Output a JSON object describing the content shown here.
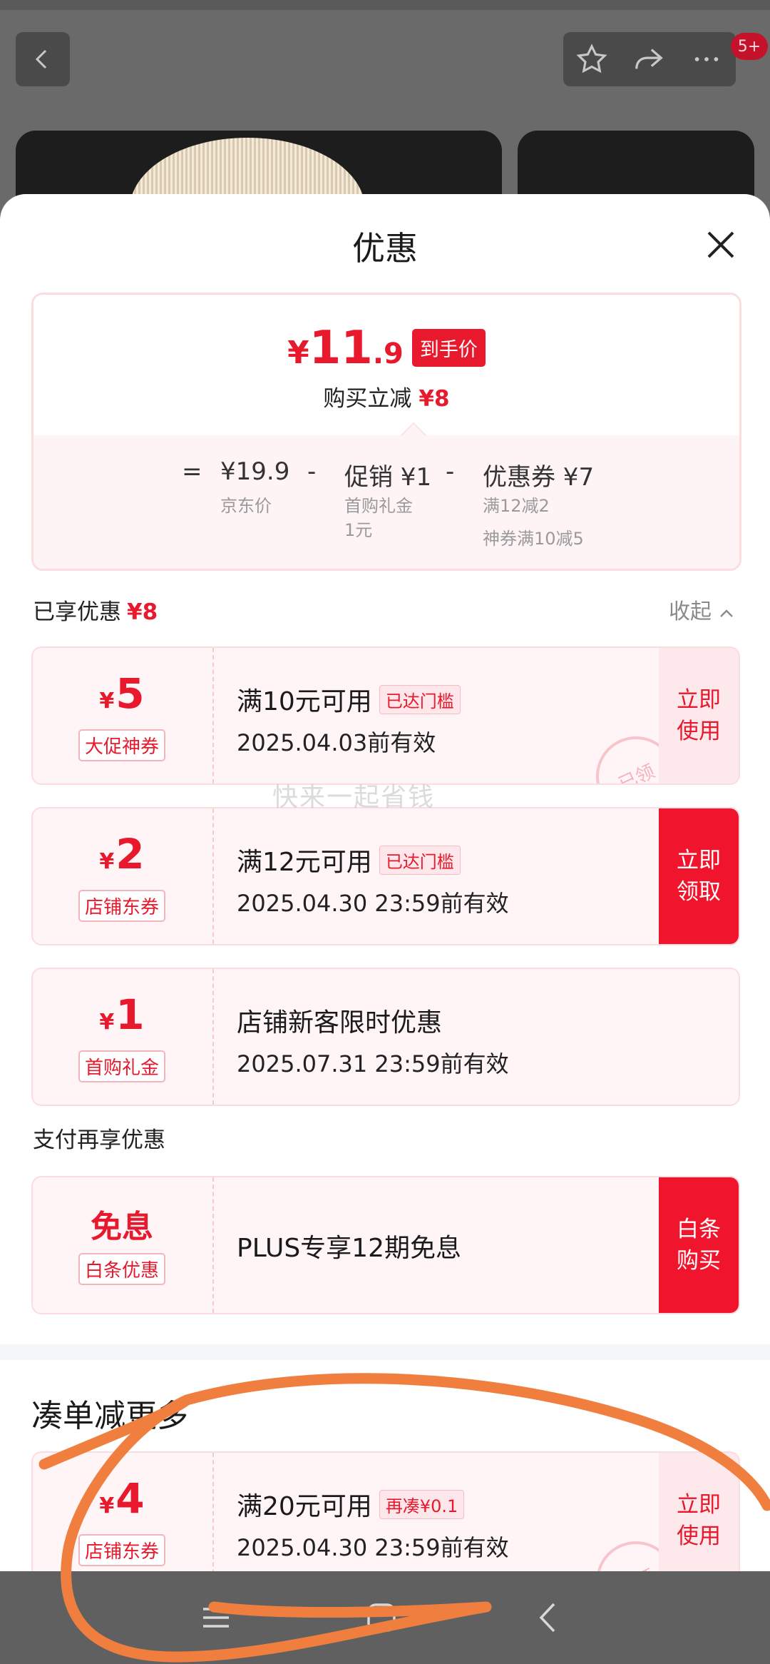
{
  "topbar": {
    "badge": "5+",
    "icons": [
      "back-icon",
      "star-icon",
      "share-icon",
      "more-icon"
    ]
  },
  "sheet": {
    "title": "优惠",
    "price": {
      "currency": "¥",
      "integer": "11",
      "decimal": ".9",
      "tag": "到手价",
      "reduce_label": "购买立减",
      "reduce_amount": "¥8"
    },
    "calc": {
      "equals": "=",
      "minus": "-",
      "base_value": "¥19.9",
      "base_label": "京东价",
      "promo_value": "促销 ¥1",
      "promo_note1": "首购礼金",
      "promo_note2": "1元",
      "coupon_value": "优惠券 ¥7",
      "coupon_note1": "满12减2",
      "coupon_note2": "神券满10减5"
    },
    "enjoyed": {
      "label": "已享优惠",
      "amount": "¥8",
      "collapse_label": "收起"
    },
    "coupons": [
      {
        "currency": "¥",
        "amount": "5",
        "type": "大促神券",
        "condition": "满10元可用",
        "badge": "已达门槛",
        "valid": "2025.04.03前有效",
        "button": "立即\n使用",
        "stamp": "已领"
      },
      {
        "currency": "¥",
        "amount": "2",
        "type": "店铺东券",
        "condition": "满12元可用",
        "badge": "已达门槛",
        "valid": "2025.04.30 23:59前有效",
        "button": "立即\n领取"
      },
      {
        "currency": "¥",
        "amount": "1",
        "type": "首购礼金",
        "title": "店铺新客限时优惠",
        "valid": "2025.07.31 23:59前有效"
      }
    ],
    "pay": {
      "label": "支付再享优惠",
      "word": "免息",
      "type": "白条优惠",
      "title": "PLUS专享12期免息",
      "button": "白条\n购买"
    },
    "watermark": "快来一起省钱",
    "more": {
      "title": "凑单减更多",
      "coupon": {
        "currency": "¥",
        "amount": "4",
        "type": "店铺东券",
        "condition": "满20元可用",
        "badge": "再凑¥0.1",
        "valid": "2025.04.30 23:59前有效",
        "button": "立即\n使用",
        "stamp": "已领"
      }
    }
  },
  "nav": {
    "icons": [
      "menu-icon",
      "home-icon",
      "back-nav-icon"
    ]
  },
  "colors": {
    "accent": "#e8192c",
    "coupon_bg": "#fff5f6",
    "scribble": "#f07f3f"
  }
}
